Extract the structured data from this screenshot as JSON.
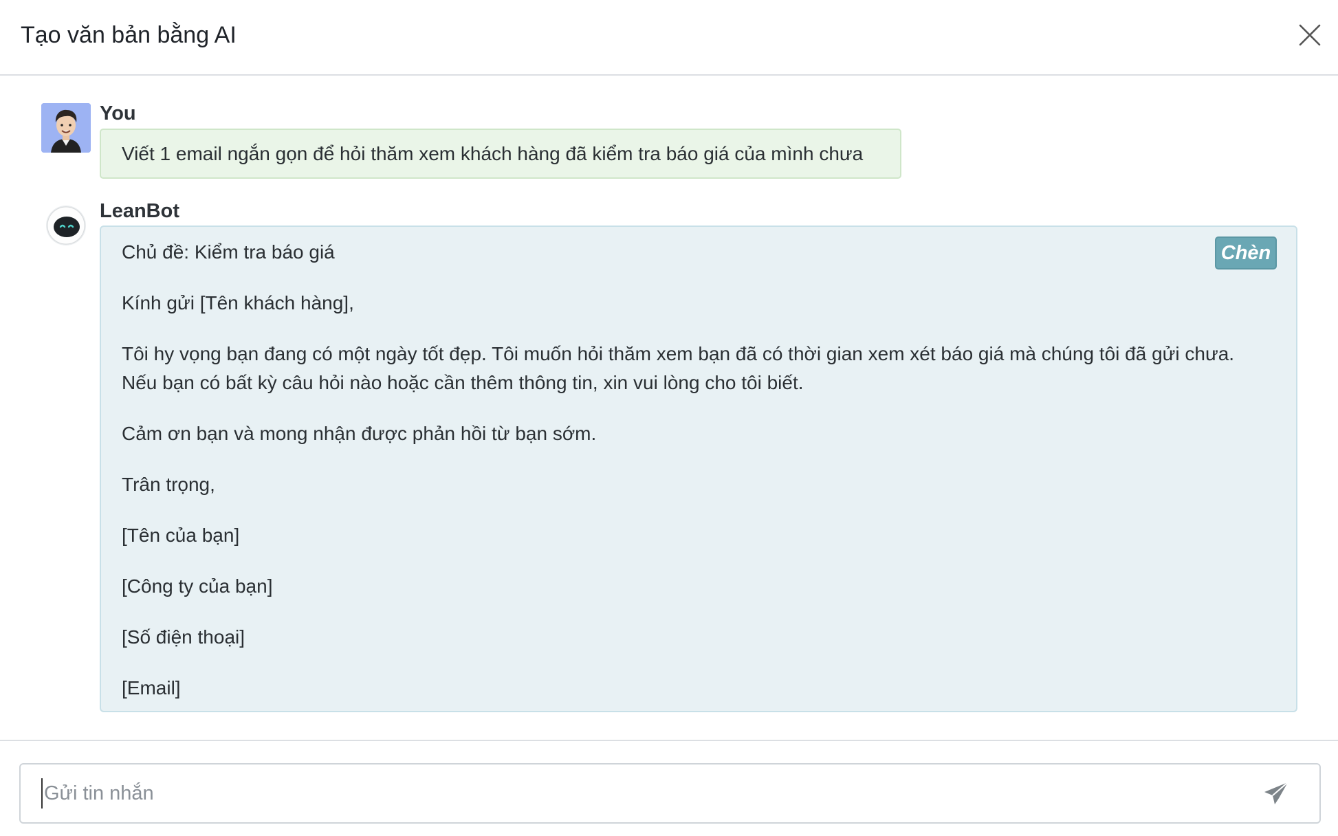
{
  "header": {
    "title": "Tạo văn bản bằng AI"
  },
  "messages": {
    "user": {
      "sender": "You",
      "text": "Viết 1 email ngắn gọn để hỏi thăm xem khách hàng đã kiểm tra báo giá của mình chưa"
    },
    "bot": {
      "sender": "LeanBot",
      "insert_label": "Chèn",
      "lines": [
        "Chủ đề: Kiểm tra báo giá",
        "Kính gửi [Tên khách hàng],",
        "Tôi hy vọng bạn đang có một ngày tốt đẹp. Tôi muốn hỏi thăm xem bạn đã có thời gian xem xét báo giá mà chúng tôi đã gửi chưa.",
        "Nếu bạn có bất kỳ câu hỏi nào hoặc cần thêm thông tin, xin vui lòng cho tôi biết.",
        "Cảm ơn bạn và mong nhận được phản hồi từ bạn sớm.",
        "Trân trọng,",
        "[Tên của bạn]",
        "[Công ty của bạn]",
        "[Số điện thoại]",
        "[Email]"
      ]
    }
  },
  "composer": {
    "placeholder": "Gửi tin nhắn",
    "value": ""
  },
  "icons": {
    "close": "close-icon",
    "send": "send-icon",
    "user_avatar": "user-avatar-icon",
    "bot_avatar": "bot-avatar-icon"
  },
  "colors": {
    "user_bubble": "#eaf5e8",
    "bot_bubble": "#e8f1f4",
    "insert_button": "#6aa7b4"
  }
}
